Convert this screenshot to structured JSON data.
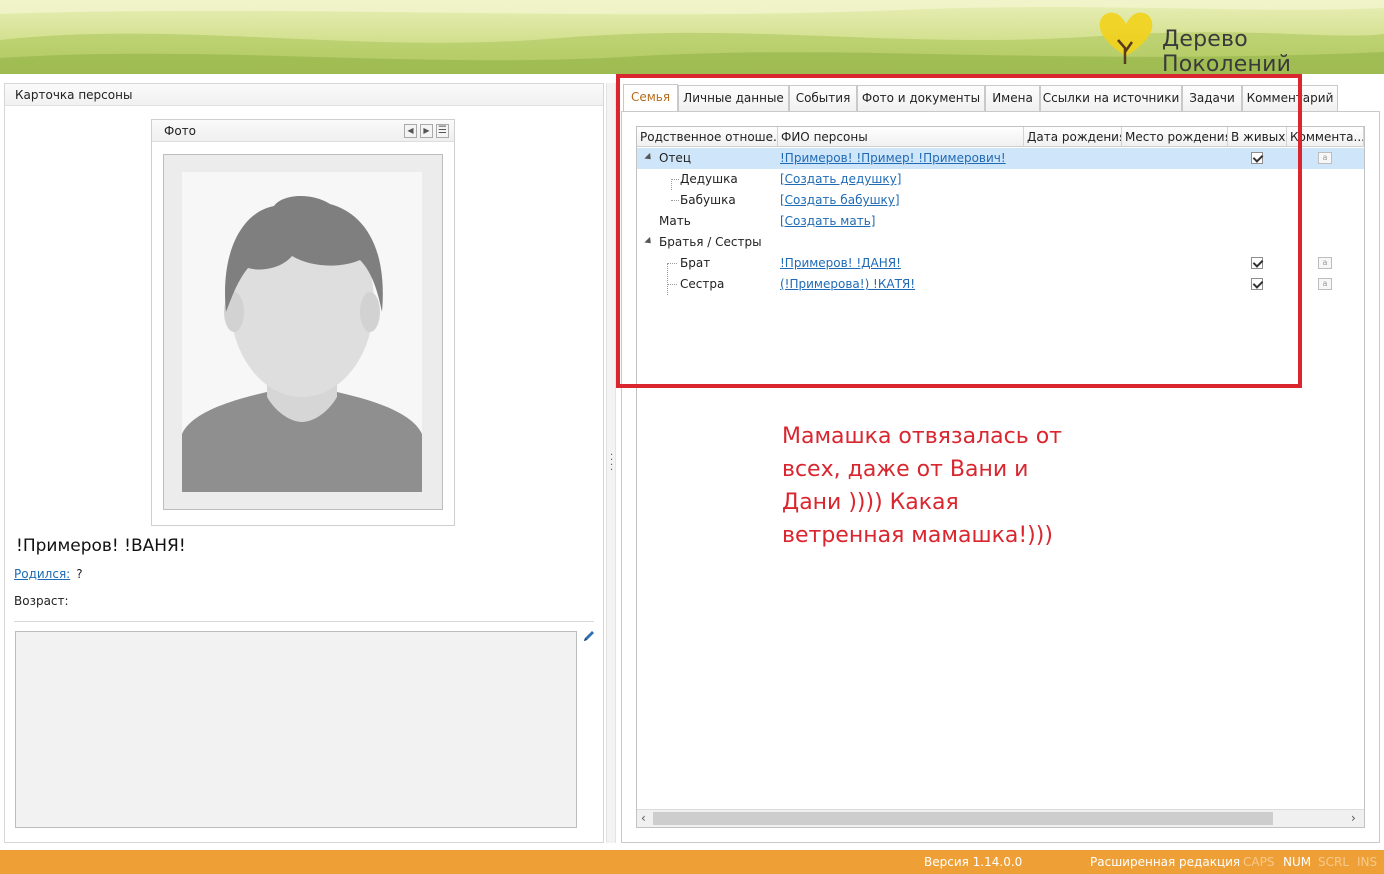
{
  "header": {
    "app_title": "Дерево Поколений"
  },
  "left_panel": {
    "title": "Карточка персоны",
    "photo": {
      "title": "Фото"
    },
    "person_name": "!Примеров! !ВАНЯ!",
    "born_label": "Родился:",
    "born_value": "?",
    "age_label": "Возраст:"
  },
  "tabs": [
    {
      "label": "Семья",
      "active": true
    },
    {
      "label": "Личные данные"
    },
    {
      "label": "События"
    },
    {
      "label": "Фото и документы"
    },
    {
      "label": "Имена"
    },
    {
      "label": "Ссылки на источники"
    },
    {
      "label": "Задачи"
    },
    {
      "label": "Комментарий"
    }
  ],
  "grid": {
    "columns": [
      "Родственное отноше...",
      "ФИО персоны",
      "Дата рождения",
      "Место рождения",
      "В живых",
      "Коммента..."
    ],
    "rows": [
      {
        "relation": "Отец",
        "name": "!Примеров! !Пример! !Примерович!",
        "alive": true,
        "note": true,
        "level": 0,
        "expandable": true,
        "selected": true
      },
      {
        "relation": "Дедушка",
        "name": "[Создать дедушку]",
        "alive": false,
        "note": false,
        "level": 1
      },
      {
        "relation": "Бабушка",
        "name": "[Создать бабушку]",
        "alive": false,
        "note": false,
        "level": 1
      },
      {
        "relation": "Мать",
        "name": "[Создать мать]",
        "alive": false,
        "note": false,
        "level": 0
      },
      {
        "relation": "Братья / Сестры",
        "name": "",
        "alive": false,
        "note": false,
        "level": 0,
        "expandable": true
      },
      {
        "relation": "Брат",
        "name": "!Примеров! !ДАНЯ!",
        "alive": true,
        "note": true,
        "level": 1
      },
      {
        "relation": "Сестра",
        "name": "(!Примерова!) !КАТЯ!",
        "alive": true,
        "note": true,
        "level": 1
      }
    ]
  },
  "annotation": "Мамашка отвязалась от всех, даже от Вани и Дани )))) Какая ветренная мамашка!)))",
  "status_bar": {
    "version": "Версия 1.14.0.0",
    "edition": "Расширенная редакция",
    "caps": "CAPS",
    "num": "NUM",
    "scrl": "SCRL",
    "ins": "INS"
  },
  "colors": {
    "accent": "#eea037",
    "annotation_red": "#d9262f",
    "link_blue": "#1f6bb5",
    "selected_row": "#cfe5fa"
  }
}
